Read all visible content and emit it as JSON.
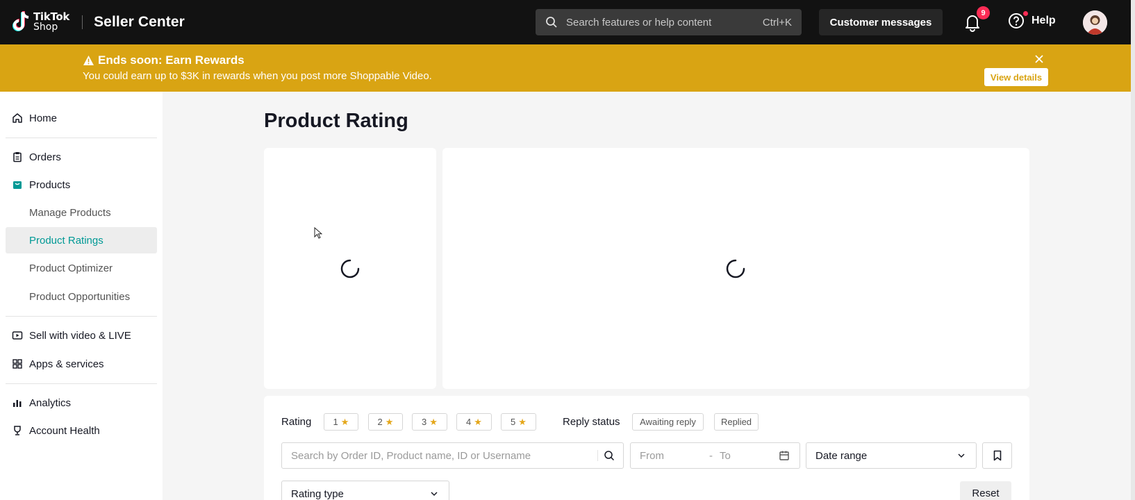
{
  "topbar": {
    "logo_line1": "TikTok",
    "logo_line2": "Shop",
    "app_title": "Seller Center",
    "search_placeholder": "Search features or help content",
    "search_shortcut": "Ctrl+K",
    "customer_messages": "Customer messages",
    "notification_count": "9",
    "help_label": "Help"
  },
  "banner": {
    "title": "Ends soon: Earn Rewards",
    "message": "You could earn up to $3K in rewards when you post more Shoppable Video.",
    "view_details": "View details",
    "color": "#d9a413"
  },
  "sidebar": {
    "home": "Home",
    "orders": "Orders",
    "products": "Products",
    "manage_products": "Manage Products",
    "product_ratings": "Product Ratings",
    "product_optimizer": "Product Optimizer",
    "product_opportunities": "Product Opportunities",
    "sell_video_live": "Sell with video & LIVE",
    "apps_services": "Apps & services",
    "analytics": "Analytics",
    "account_health": "Account Health",
    "active_color": "#009995"
  },
  "main": {
    "title": "Product Rating",
    "rating_label": "Rating",
    "rating_chips": [
      "1",
      "2",
      "3",
      "4",
      "5"
    ],
    "star": "★",
    "reply_status_label": "Reply status",
    "reply_chips": [
      "Awaiting reply",
      "Replied"
    ],
    "search_placeholder": "Search by Order ID, Product name, ID or Username",
    "date_from": "From",
    "date_sep": "-",
    "date_to": "To",
    "date_range": "Date range",
    "rating_type": "Rating type",
    "reset": "Reset"
  }
}
